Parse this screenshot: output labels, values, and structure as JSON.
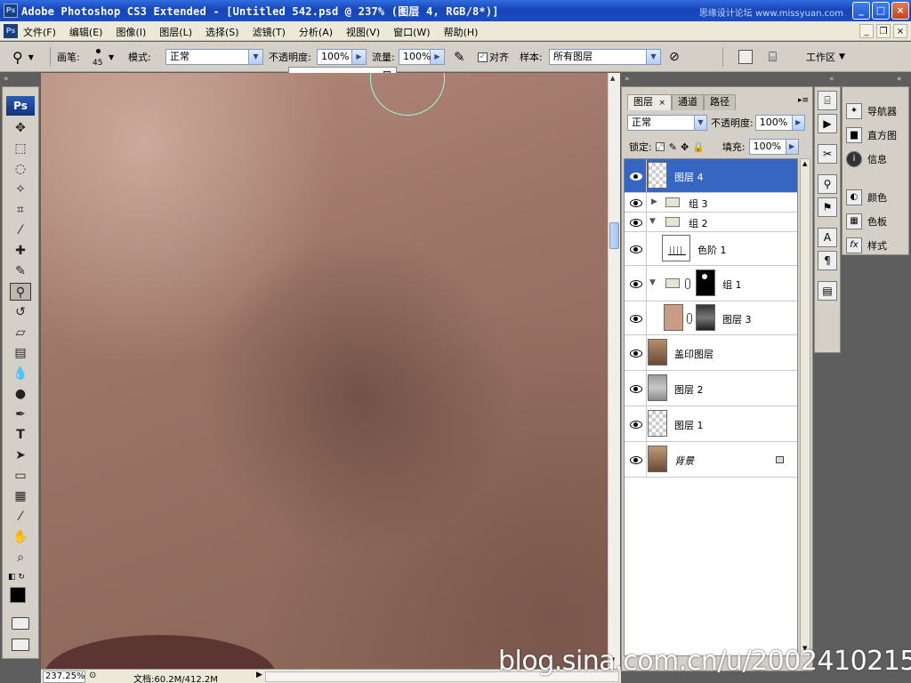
{
  "window": {
    "title": "Adobe Photoshop CS3 Extended - [Untitled 542.psd @ 237% (图层 4, RGB/8*)]",
    "app_badge": "Ps",
    "site_watermark": "思缘设计论坛 www.missyuan.com"
  },
  "menu": {
    "items": [
      "文件(F)",
      "编辑(E)",
      "图像(I)",
      "图层(L)",
      "选择(S)",
      "滤镜(T)",
      "分析(A)",
      "视图(V)",
      "窗口(W)",
      "帮助(H)"
    ]
  },
  "options": {
    "brush_label": "画笔:",
    "brush_size": "45",
    "mode_label": "模式:",
    "mode_value": "正常",
    "opacity_label": "不透明度:",
    "opacity_value": "100%",
    "flow_label": "流量:",
    "flow_value": "100%",
    "aligned_label": "对齐",
    "aligned_checked": true,
    "sample_label": "样本:",
    "sample_value": "所有图层",
    "workspace_label": "工作区",
    "opacity_slider_fraction": 1.0
  },
  "toolbox": {
    "logo": "Ps",
    "tools": [
      "move-tool",
      "marquee-tool",
      "lasso-tool",
      "magic-wand-tool",
      "crop-tool",
      "slice-tool",
      "healing-brush-tool",
      "brush-tool",
      "clone-stamp-tool",
      "history-brush-tool",
      "eraser-tool",
      "gradient-tool",
      "blur-tool",
      "dodge-tool",
      "pen-tool",
      "type-tool",
      "path-selection-tool",
      "shape-tool",
      "notes-tool",
      "eyedropper-tool",
      "hand-tool",
      "zoom-tool"
    ],
    "active_tool": "clone-stamp-tool",
    "foreground_color": "#000000",
    "background_color": "#ffffff"
  },
  "status": {
    "zoom": "237.25%",
    "doc_info": "文档:60.2M/412.2M"
  },
  "layers_panel": {
    "tabs": [
      "图层",
      "通道",
      "路径"
    ],
    "active_tab": "图层",
    "blend_mode": "正常",
    "opacity_label": "不透明度:",
    "opacity_value": "100%",
    "lock_label": "锁定:",
    "fill_label": "填充:",
    "fill_value": "100%",
    "layers": [
      {
        "name": "图层 4",
        "type": "pixel",
        "selected": true,
        "visible": true
      },
      {
        "name": "组 3",
        "type": "group",
        "expanded": false,
        "visible": true
      },
      {
        "name": "组 2",
        "type": "group",
        "expanded": true,
        "visible": true
      },
      {
        "name": "色阶 1",
        "type": "adjustment",
        "visible": true
      },
      {
        "name": "组 1",
        "type": "group-masked",
        "expanded": true,
        "visible": true
      },
      {
        "name": "图层 3",
        "type": "pixel-masked",
        "visible": true
      },
      {
        "name": "盖印图层",
        "type": "pixel",
        "visible": true
      },
      {
        "name": "图层 2",
        "type": "pixel",
        "visible": true
      },
      {
        "name": "图层 1",
        "type": "pixel",
        "visible": true
      },
      {
        "name": "背景",
        "type": "background",
        "locked": true,
        "visible": true
      }
    ]
  },
  "right_panel": {
    "items": [
      {
        "label": "导航器",
        "icon": "navigator-icon"
      },
      {
        "label": "直方图",
        "icon": "histogram-icon"
      },
      {
        "label": "信息",
        "icon": "info-icon"
      },
      {
        "label": "颜色",
        "icon": "color-icon"
      },
      {
        "label": "色板",
        "icon": "swatches-icon"
      },
      {
        "label": "样式",
        "icon": "styles-icon"
      }
    ]
  },
  "overlay": {
    "watermark": "blog.sina.com.cn/u/2002410215"
  }
}
